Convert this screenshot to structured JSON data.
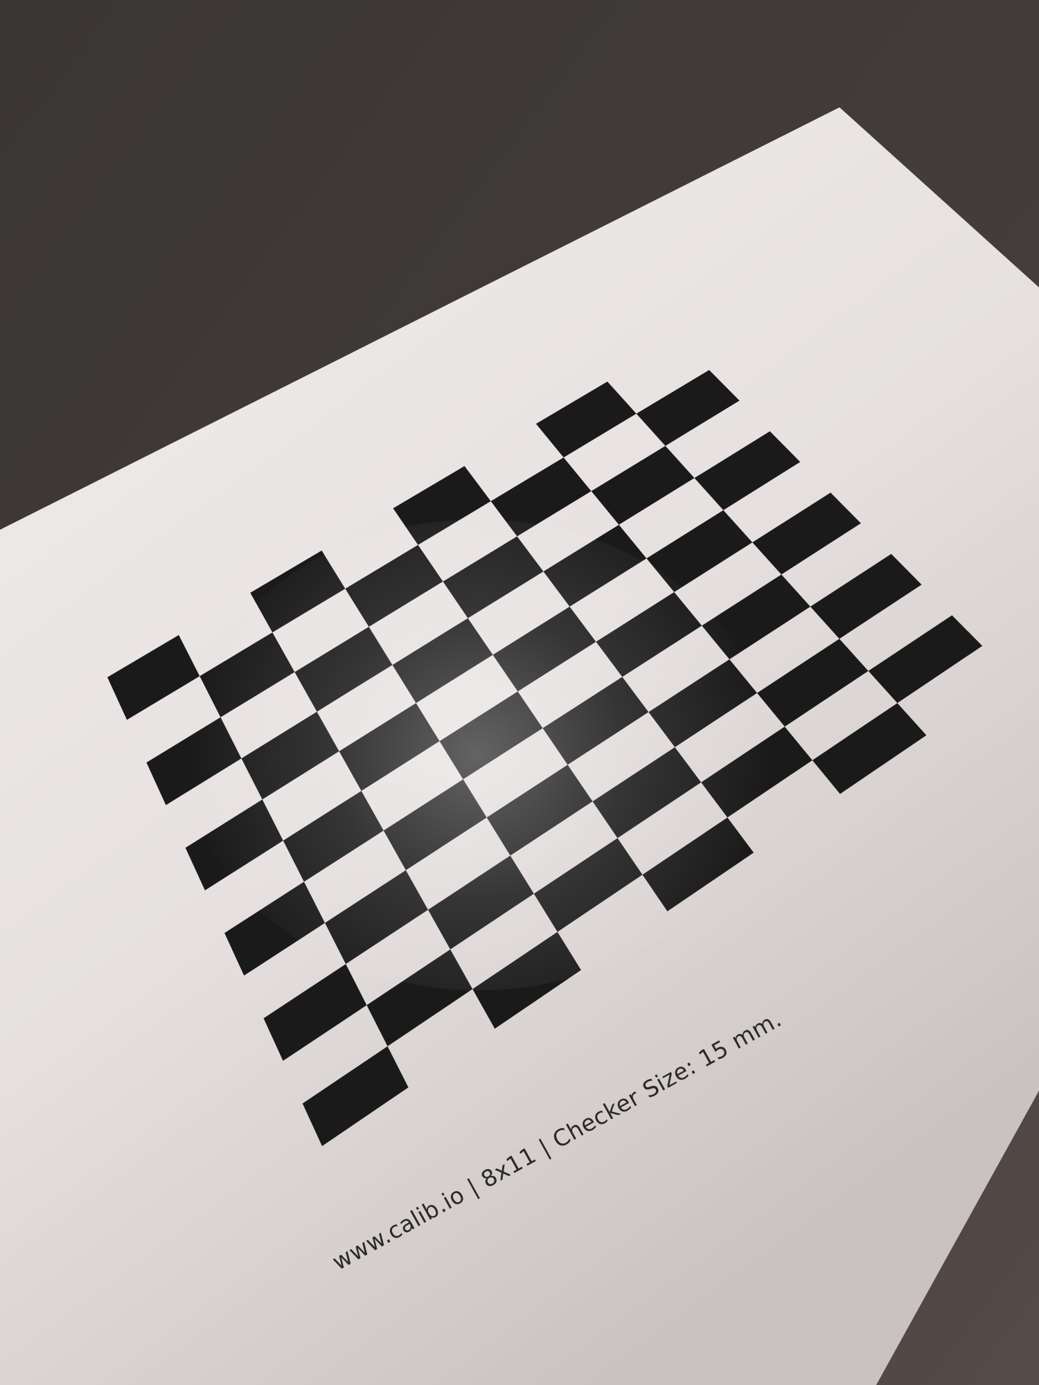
{
  "photo": {
    "subject": "printed checkerboard calibration target on paper",
    "caption": "www.calib.io | 8x11 | Checker Size: 15 mm.",
    "pattern": {
      "rows": 8,
      "columns": 11,
      "square_color": "#1b1a1a",
      "paper_color": "#ebe7e6"
    },
    "background_color": "#3d3836"
  }
}
